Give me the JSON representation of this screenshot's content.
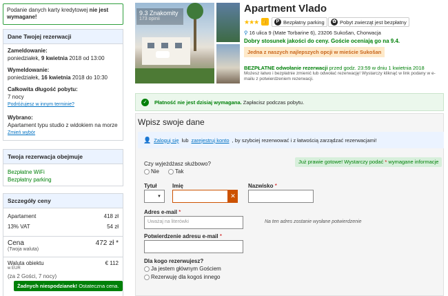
{
  "notice": {
    "text": "Podanie danych karty kredytowej",
    "bold": "nie jest wymagane!"
  },
  "reservation": {
    "title": "Dane Twojej rezerwacji",
    "checkin_label": "Zameldowanie:",
    "checkin_day": "poniedziałek, ",
    "checkin_date": "9 kwietnia",
    "checkin_rest": " 2018 od 13:00",
    "checkout_label": "Wymeldowanie:",
    "checkout_day": "poniedziałek, ",
    "checkout_date": "16 kwietnia",
    "checkout_rest": " 2018 do 10:30",
    "length_label": "Całkowita długość pobytu:",
    "length_value": "7 nocy",
    "other_term_link": "Podróżujesz w innym terminie?",
    "chosen_label": "Wybrano:",
    "chosen_value": "Apartament typu studio z widokiem na morze",
    "change_link": "Zmień wybór"
  },
  "includes": {
    "title": "Twoja rezerwacja obejmuje",
    "items": [
      "Bezpłatne WiFi",
      "Bezpłatny parking"
    ]
  },
  "price": {
    "title": "Szczegóły ceny",
    "rows": [
      {
        "label": "Apartament",
        "value": "418 zł"
      },
      {
        "label": "13% VAT",
        "value": "54 zł"
      }
    ],
    "total_label": "Cena",
    "total_value": "472 zł *",
    "total_sub": "(Twoja waluta)",
    "currency_label": "Waluta obiektu",
    "currency_code": "w EUR",
    "currency_value": "€ 112",
    "guests": "(za 2 Gości, 7 nocy)",
    "tag_bold": "Żadnych niespodzianek!",
    "tag_rest": " Ostateczna cena."
  },
  "hotel": {
    "score": "9.3 Znakomity",
    "reviews": "173 opinii",
    "name": "Apartment Vlado",
    "stars": "★★★",
    "facility_parking": "Bezpłatny parking",
    "facility_pets": "Pobyt zwierząt jest bezpłatny",
    "address": "16 ulica 9 (Mate Torbarine 6), 23206 Sukošan, Chorwacja",
    "good_value": "Dobry stosunek jakości do ceny. Goście oceniają go na 9.4.",
    "best_option": "Jedna z naszych najlepszych opcji w mieście Sukošan",
    "cancel_bold": "BEZPŁATNE odwołanie rezerwacji",
    "cancel_rest": " przed godz. 23:59 w dniu 1 kwietnia 2018",
    "cancel_sub": "Możesz łatwo i bezpłatnie zmienić lub odwołać rezerwację! Wystarczy kliknąć w link podany w e-mailu z potwierdzeniem rezerwacji."
  },
  "payment": {
    "bold": "Płatność nie jest dzisiaj wymagana.",
    "rest": " Zapłacisz podczas pobytu."
  },
  "form": {
    "title": "Wpisz swoje dane",
    "login_link": "Zaloguj się",
    "or": " lub ",
    "register_link": "zarejestruj konto",
    "login_rest": ", by szybciej rezerwować i z łatwością zarządzać rezerwacjami!",
    "business_q": "Czy wyjeżdżasz służbowo?",
    "no": "Nie",
    "yes": "Tak",
    "ready_text": "Już prawie gotowe! Wystarczy podać ",
    "ready_star": "*",
    "ready_rest": " wymagane informacje",
    "title_label": "Tytuł",
    "first_label": "Imię",
    "last_label": "Nazwisko",
    "star": "*",
    "email_label": "Adres e-mail",
    "email_placeholder": "Uważaj na literówki",
    "email_hint": "Na ten adres zostanie wysłane potwierdzenie",
    "confirm_label": "Potwierdzenie adresu e-mail",
    "for_whom": "Dla kogo rezerwujesz?",
    "opt_main": "Ja jestem głównym Gościem",
    "opt_other": "Rezerwuję dla kogoś innego"
  }
}
